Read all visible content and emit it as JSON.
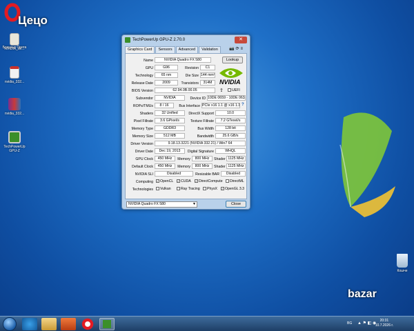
{
  "desktop": {
    "corner_text": "Цецо",
    "icons": [
      {
        "label": "Браузър Opera"
      },
      {
        "label": "NVIDIA_dri..."
      },
      {
        "label": "nvidia_332..."
      },
      {
        "label": "nvidia_332..."
      },
      {
        "label": "TechPowerUp GPU-Z"
      },
      {
        "label": "Кошче"
      }
    ],
    "watermark": "bazar"
  },
  "window": {
    "title": "TechPowerUp GPU-Z 2.70.0",
    "tabs": [
      "Graphics Card",
      "Sensors",
      "Advanced",
      "Validation"
    ],
    "rows": [
      {
        "label": "Name",
        "value": "NVIDIA Quadro FX 580"
      },
      {
        "label": "GPU",
        "value": "G96",
        "label2": "Revision",
        "value2": "C1"
      },
      {
        "label": "Technology",
        "value": "65 nm",
        "label2": "Die Size",
        "value2": "144 mm²"
      },
      {
        "label": "Release Date",
        "value": "2009",
        "label2": "Transistors",
        "value2": "314M"
      },
      {
        "label": "BIOS Version",
        "value": "62.94.0B.00.05"
      },
      {
        "label": "Subvendor",
        "value": "NVIDIA",
        "label2": "Device ID",
        "value2": "10DE 0659 - 10DE 063A"
      },
      {
        "label": "ROPs/TMUs",
        "value": "8 / 16",
        "label2": "Bus Interface",
        "value2": "PCIe x16 1.1 @ x16 1.1"
      },
      {
        "label": "Shaders",
        "value": "32 Unified",
        "label2": "DirectX Support",
        "value2": "10.0"
      },
      {
        "label": "Pixel Fillrate",
        "value": "3.6 GPixel/s",
        "label2": "Texture Fillrate",
        "value2": "7.2 GTexel/s"
      },
      {
        "label": "Memory Type",
        "value": "GDDR3",
        "label2": "Bus Width",
        "value2": "128 bit"
      },
      {
        "label": "Memory Size",
        "value": "512 MB",
        "label2": "Bandwidth",
        "value2": "25.6 GB/s"
      },
      {
        "label": "Driver Version",
        "value": "9.18.13.3221 (NVIDIA 332.21) / Win7 64"
      },
      {
        "label": "Driver Date",
        "value": "Dec 19, 2013",
        "label2": "Digital Signature",
        "value2": "WHQL"
      }
    ],
    "clocks": [
      {
        "label": "GPU Clock",
        "gpu": "450 MHz",
        "mem_label": "Memory",
        "mem": "800 MHz",
        "sh_label": "Shader",
        "shader": "1125 MHz"
      },
      {
        "label": "Default Clock",
        "gpu": "450 MHz",
        "mem_label": "Memory",
        "mem": "800 MHz",
        "sh_label": "Shader",
        "shader": "1125 MHz"
      }
    ],
    "sli": {
      "label": "NVIDIA SLI",
      "value": "Disabled",
      "label2": "Resizable BAR",
      "value2": "Disabled"
    },
    "computing": {
      "label": "Computing",
      "items": [
        {
          "name": "OpenCL",
          "checked": true
        },
        {
          "name": "CUDA",
          "checked": true
        },
        {
          "name": "DirectCompute",
          "checked": true
        },
        {
          "name": "DirectML",
          "checked": false
        }
      ]
    },
    "technologies": {
      "label": "Technologies",
      "items": [
        {
          "name": "Vulkan",
          "checked": false
        },
        {
          "name": "Ray Tracing",
          "checked": false
        },
        {
          "name": "PhysX",
          "checked": false
        },
        {
          "name": "OpenGL 3.3",
          "checked": true
        }
      ]
    },
    "lookup_label": "Lookup",
    "uefi_label": "UEFI",
    "vendor_logo_text": "NVIDIA",
    "gpu_select": "NVIDIA Quadro FX 580",
    "close_label": "Close",
    "help": "?"
  },
  "taskbar": {
    "lang": "BG",
    "time": "20:31",
    "date": "10.7.2026 г."
  },
  "colors": {
    "accent": "#76b900",
    "desktop": "#1e6fc7"
  }
}
